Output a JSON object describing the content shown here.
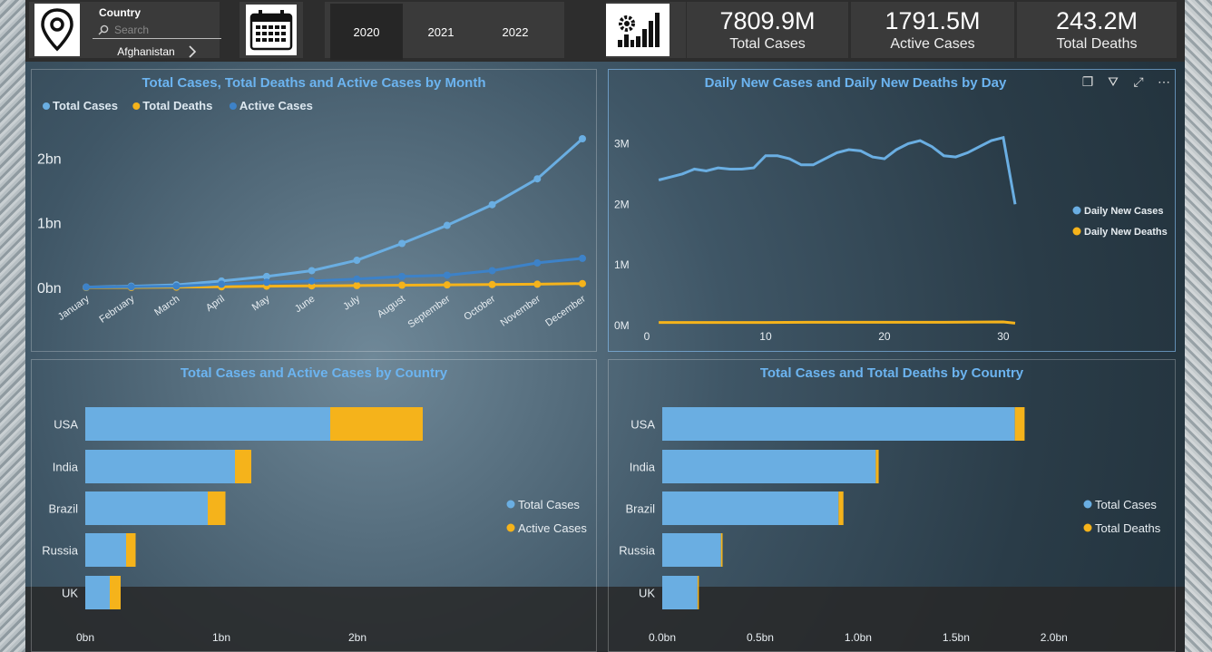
{
  "filter": {
    "title": "Country",
    "search_placeholder": "Search",
    "selected": "Afghanistan"
  },
  "years": [
    "2020",
    "2021",
    "2022"
  ],
  "selected_year": "2020",
  "kpis": [
    {
      "value": "7809.9M",
      "label": "Total Cases"
    },
    {
      "value": "1791.5M",
      "label": "Active Cases"
    },
    {
      "value": "243.2M",
      "label": "Total Deaths"
    }
  ],
  "colors": {
    "light_blue": "#6aaee2",
    "orange": "#f5b31b",
    "dark_blue": "#3d82c8",
    "title_blue": "#6cb4f0"
  },
  "chart_data": [
    {
      "type": "line",
      "title": "Total Cases, Total Deaths and Active Cases by Month",
      "categories": [
        "January",
        "February",
        "March",
        "April",
        "May",
        "June",
        "July",
        "August",
        "September",
        "October",
        "November",
        "December"
      ],
      "series": [
        {
          "name": "Total Cases",
          "color": "#6aaee2",
          "values": [
            0.005,
            0.02,
            0.04,
            0.1,
            0.17,
            0.26,
            0.42,
            0.68,
            0.96,
            1.28,
            1.68,
            2.3
          ]
        },
        {
          "name": "Total Deaths",
          "color": "#f5b31b",
          "values": [
            0,
            0,
            0.005,
            0.01,
            0.02,
            0.025,
            0.03,
            0.035,
            0.04,
            0.045,
            0.05,
            0.06
          ]
        },
        {
          "name": "Active Cases",
          "color": "#3d82c8",
          "values": [
            0.005,
            0.01,
            0.02,
            0.05,
            0.08,
            0.1,
            0.13,
            0.17,
            0.19,
            0.26,
            0.38,
            0.45
          ]
        }
      ],
      "yticks": [
        "0bn",
        "1bn",
        "2bn"
      ],
      "ylim": [
        0,
        2.3
      ],
      "legend": "top-left"
    },
    {
      "type": "line",
      "title": "Daily New Cases and Daily New Deaths by Day",
      "series": [
        {
          "name": "Daily New Cases",
          "color": "#6aaee2",
          "x": [
            1,
            2,
            3,
            4,
            5,
            6,
            7,
            8,
            9,
            10,
            11,
            12,
            13,
            14,
            15,
            16,
            17,
            18,
            19,
            20,
            21,
            22,
            23,
            24,
            25,
            26,
            27,
            28,
            29,
            30,
            31
          ],
          "values": [
            2.4,
            2.45,
            2.5,
            2.58,
            2.55,
            2.6,
            2.58,
            2.58,
            2.6,
            2.8,
            2.8,
            2.75,
            2.65,
            2.65,
            2.75,
            2.85,
            2.9,
            2.88,
            2.78,
            2.75,
            2.9,
            3.0,
            3.05,
            2.95,
            2.8,
            2.78,
            2.85,
            2.95,
            3.05,
            3.1,
            2.0
          ]
        },
        {
          "name": "Daily New Deaths",
          "color": "#f5b31b",
          "x": [
            1,
            5,
            10,
            15,
            20,
            25,
            30,
            31
          ],
          "values": [
            0.05,
            0.05,
            0.05,
            0.055,
            0.055,
            0.055,
            0.06,
            0.04
          ]
        }
      ],
      "xticks": [
        "0",
        "10",
        "20",
        "30"
      ],
      "yticks": [
        "0M",
        "1M",
        "2M",
        "3M"
      ],
      "ylim": [
        0,
        3.2
      ],
      "legend": "right"
    },
    {
      "type": "bar",
      "title": "Total Cases and Active Cases by Country",
      "categories": [
        "USA",
        "India",
        "Brazil",
        "Russia",
        "UK"
      ],
      "series": [
        {
          "name": "Total Cases",
          "color": "#6aaee2",
          "values": [
            1.8,
            1.1,
            0.9,
            0.3,
            0.18
          ]
        },
        {
          "name": "Active Cases",
          "color": "#f5b31b",
          "values": [
            0.68,
            0.12,
            0.13,
            0.07,
            0.08
          ]
        }
      ],
      "xticks": [
        "0bn",
        "1bn",
        "2bn"
      ],
      "xlim": [
        0,
        2.4
      ],
      "legend": "right"
    },
    {
      "type": "bar",
      "title": "Total Cases and Total Deaths by Country",
      "categories": [
        "USA",
        "India",
        "Brazil",
        "Russia",
        "UK"
      ],
      "series": [
        {
          "name": "Total Cases",
          "color": "#6aaee2",
          "values": [
            1.8,
            1.09,
            0.9,
            0.3,
            0.18
          ]
        },
        {
          "name": "Total Deaths",
          "color": "#f5b31b",
          "values": [
            0.05,
            0.015,
            0.025,
            0.008,
            0.006
          ]
        }
      ],
      "xticks": [
        "0.0bn",
        "0.5bn",
        "1.0bn",
        "1.5bn",
        "2.0bn"
      ],
      "xlim": [
        0,
        2.2
      ],
      "legend": "right"
    }
  ]
}
